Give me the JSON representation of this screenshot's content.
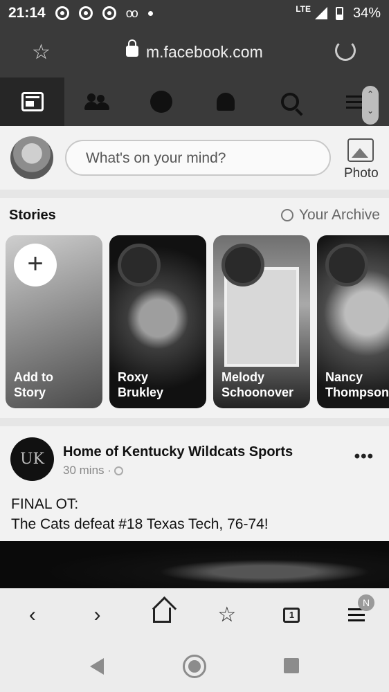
{
  "status_bar": {
    "time": "21:14",
    "network": "LTE",
    "battery": "34%"
  },
  "browser": {
    "url": "m.facebook.com"
  },
  "fb_nav": {
    "tabs": [
      "news-feed",
      "friends",
      "messenger",
      "notifications",
      "search",
      "menu"
    ]
  },
  "composer": {
    "placeholder": "What's on your mind?",
    "photo_label": "Photo"
  },
  "stories": {
    "title": "Stories",
    "archive_label": "Your Archive",
    "items": [
      {
        "name": "Add to\nStory"
      },
      {
        "name": "Roxy\nBrukley"
      },
      {
        "name": "Melody\nSchoonover"
      },
      {
        "name": "Nancy\nThompson"
      }
    ]
  },
  "post": {
    "author": "Home of Kentucky Wildcats Sports",
    "time": "30 mins ·",
    "text_line1": "FINAL OT:",
    "text_line2": "The Cats defeat #18 Texas Tech, 76-74!",
    "avatar_text": "UK"
  },
  "browser_bar": {
    "tabs_count": "1",
    "badge": "N"
  }
}
